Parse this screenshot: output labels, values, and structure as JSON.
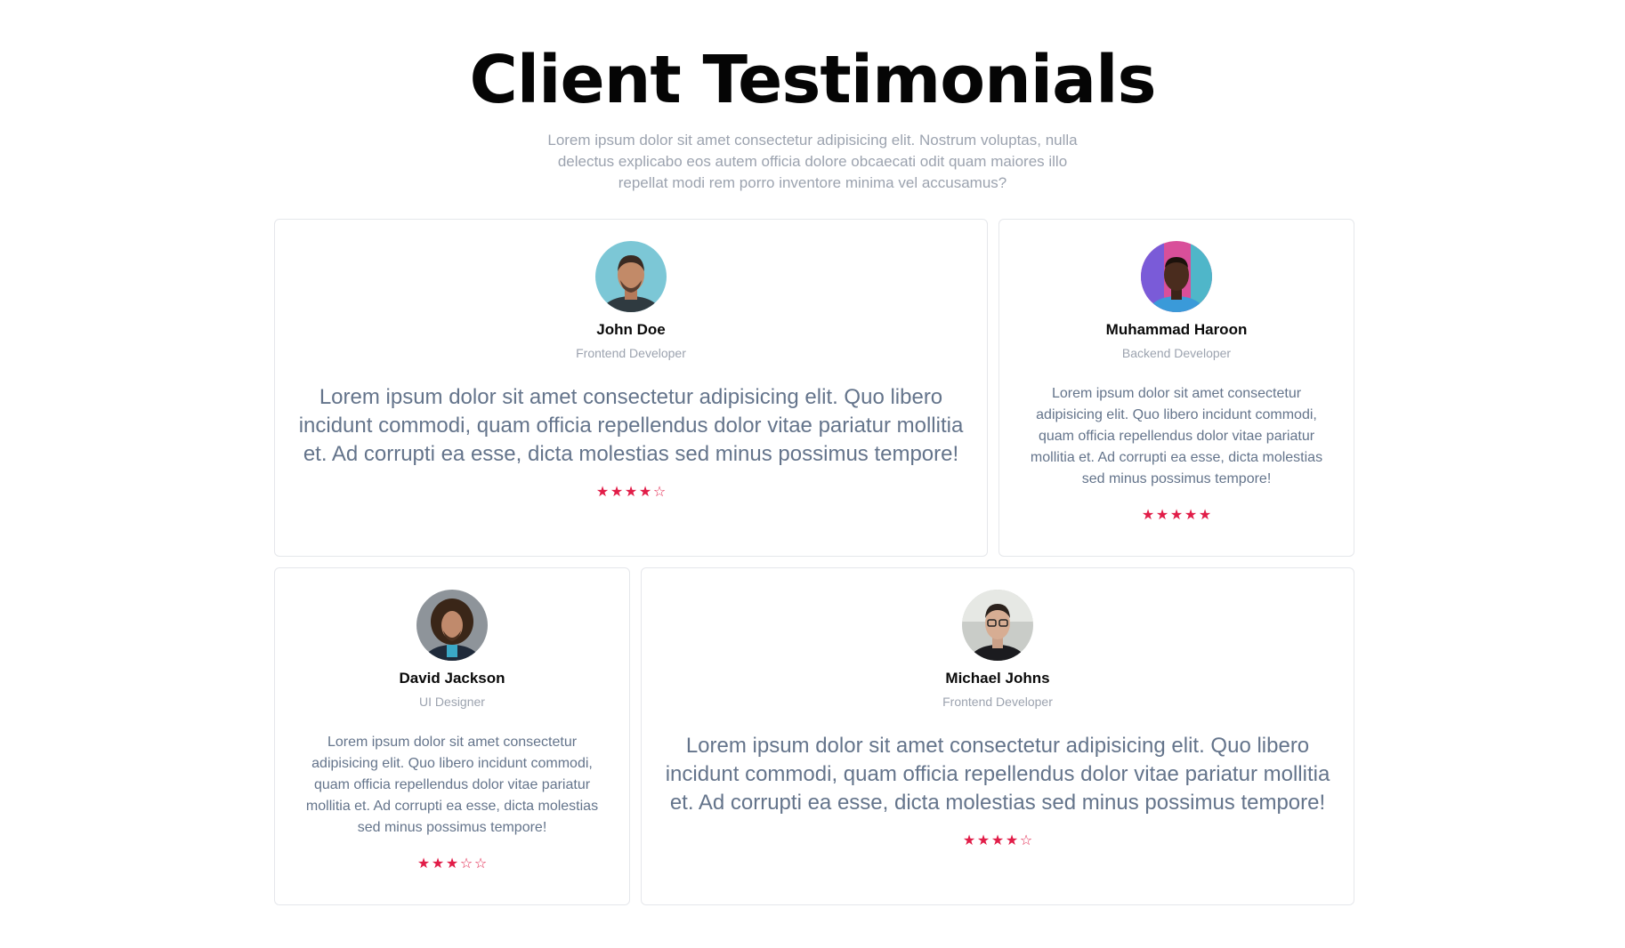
{
  "header": {
    "title": "Client Testimonials",
    "subtitle": "Lorem ipsum dolor sit amet consectetur adipisicing elit. Nostrum voluptas, nulla delectus explicabo eos autem officia dolore obcaecati odit quam maiores illo repellat modi rem porro inventore minima vel accusamus?"
  },
  "colors": {
    "star": "#e11d48",
    "muted_text": "#9ca3af",
    "body_text": "#64748b",
    "border": "#e5e7eb"
  },
  "testimonials": [
    {
      "name": "John Doe",
      "role": "Frontend Developer",
      "quote": "Lorem ipsum dolor sit amet consectetur adipisicing elit. Quo libero incidunt commodi, quam officia repellendus dolor vitae pariatur mollitia et. Ad corrupti ea esse, dicta molestias sed minus possimus tempore!",
      "rating": 4,
      "max_rating": 5,
      "avatar": "avatar-photo"
    },
    {
      "name": "Muhammad Haroon",
      "role": "Backend Developer",
      "quote": "Lorem ipsum dolor sit amet consectetur adipisicing elit. Quo libero incidunt commodi, quam officia repellendus dolor vitae pariatur mollitia et. Ad corrupti ea esse, dicta molestias sed minus possimus tempore!",
      "rating": 5,
      "max_rating": 5,
      "avatar": "avatar-photo"
    },
    {
      "name": "David Jackson",
      "role": "UI Designer",
      "quote": "Lorem ipsum dolor sit amet consectetur adipisicing elit. Quo libero incidunt commodi, quam officia repellendus dolor vitae pariatur mollitia et. Ad corrupti ea esse, dicta molestias sed minus possimus tempore!",
      "rating": 3,
      "max_rating": 5,
      "avatar": "avatar-photo"
    },
    {
      "name": "Michael Johns",
      "role": "Frontend Developer",
      "quote": "Lorem ipsum dolor sit amet consectetur adipisicing elit. Quo libero incidunt commodi, quam officia repellendus dolor vitae pariatur mollitia et. Ad corrupti ea esse, dicta molestias sed minus possimus tempore!",
      "rating": 4,
      "max_rating": 5,
      "avatar": "avatar-photo"
    }
  ]
}
